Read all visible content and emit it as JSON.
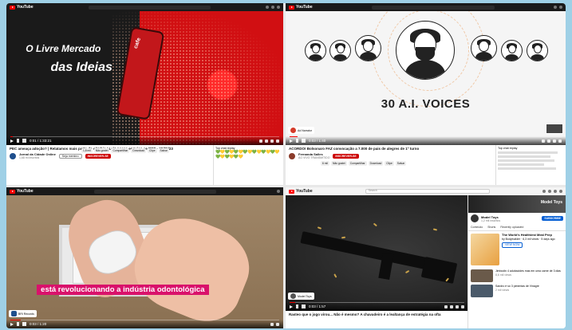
{
  "yt_label": "YouTube",
  "panel1": {
    "title_line1": "O Livre Mercado",
    "title_line2": "das Ideias",
    "phone_logo": "cafe",
    "time": "0:01 / 1:33:21",
    "video_title": "PEC ameaça adoção? | Relatamos mais parte do câmbio / Luiz posso enguiço se BRT · 20/05/23",
    "channel": "Jornal da Cidade Online",
    "subs": "1,68 mi inscritos",
    "join": "Seja membro",
    "subscribe": "INSCREVER-SE",
    "actions": [
      "1,8 mil",
      "Não gostei",
      "Compartilhar",
      "Download",
      "Clipe",
      "Salvar"
    ],
    "chat_title": "Top chat replay",
    "emojis": "💚💛💚💛💚💛💚💛💚💛💚💛💚💛💚💛💚💛💚💛"
  },
  "panel2": {
    "title": "30 A.I. VOICES",
    "channel_pill": "Ad Narrator",
    "time": "0:03 / 1:40",
    "video_title": "ACORDO! Bolsonaro FAZ convocação a 7.000 de pais de alegres de 1º turno",
    "channel": "Fernanda Salles",
    "channel_note": "AO VIVO TRANSMITIDO",
    "subscribe": "INSCREVER-SE",
    "actions": [
      "6 mil",
      "Não gostei",
      "Compartilhar",
      "Download",
      "Clipe",
      "Salvar"
    ],
    "chat_title": "Top chat replay"
  },
  "panel3": {
    "caption": "está revolucionando a indústria odontológica",
    "channel_pill": "BRI Records",
    "time": "0:03 / 1:20"
  },
  "panel4": {
    "search_placeholder": "Search",
    "channel_pill": "Model Toys",
    "time": "0:03 / 1:57",
    "video_title": "Rasteo que o jogo virou... Não é mesmo? A chavadeiro é a lealtança de estratégia na ofta",
    "side_banner": "Model Toys",
    "side_channel": "Model Toys",
    "side_subs": "1,2 mil inscritos",
    "side_sub_btn": "SUBSCRIBE",
    "tabs": [
      "Conteúdo",
      "Shorts",
      "Recently uploaded"
    ],
    "feat_title": "The World's Healthiest Meal Prep",
    "feat_meta": "by Bodybuilder · 6,3 mil views · 5 days ago",
    "feat_btn": "VIEW NOW",
    "list": [
      {
        "title": "Jimbodin 4 adubacides mas em uma carne de 3 dias",
        "meta": "8,6 mil views"
      },
      {
        "title": "Sandro é só 3 pimentas de Vinagre",
        "meta": "2 mil views"
      }
    ]
  }
}
